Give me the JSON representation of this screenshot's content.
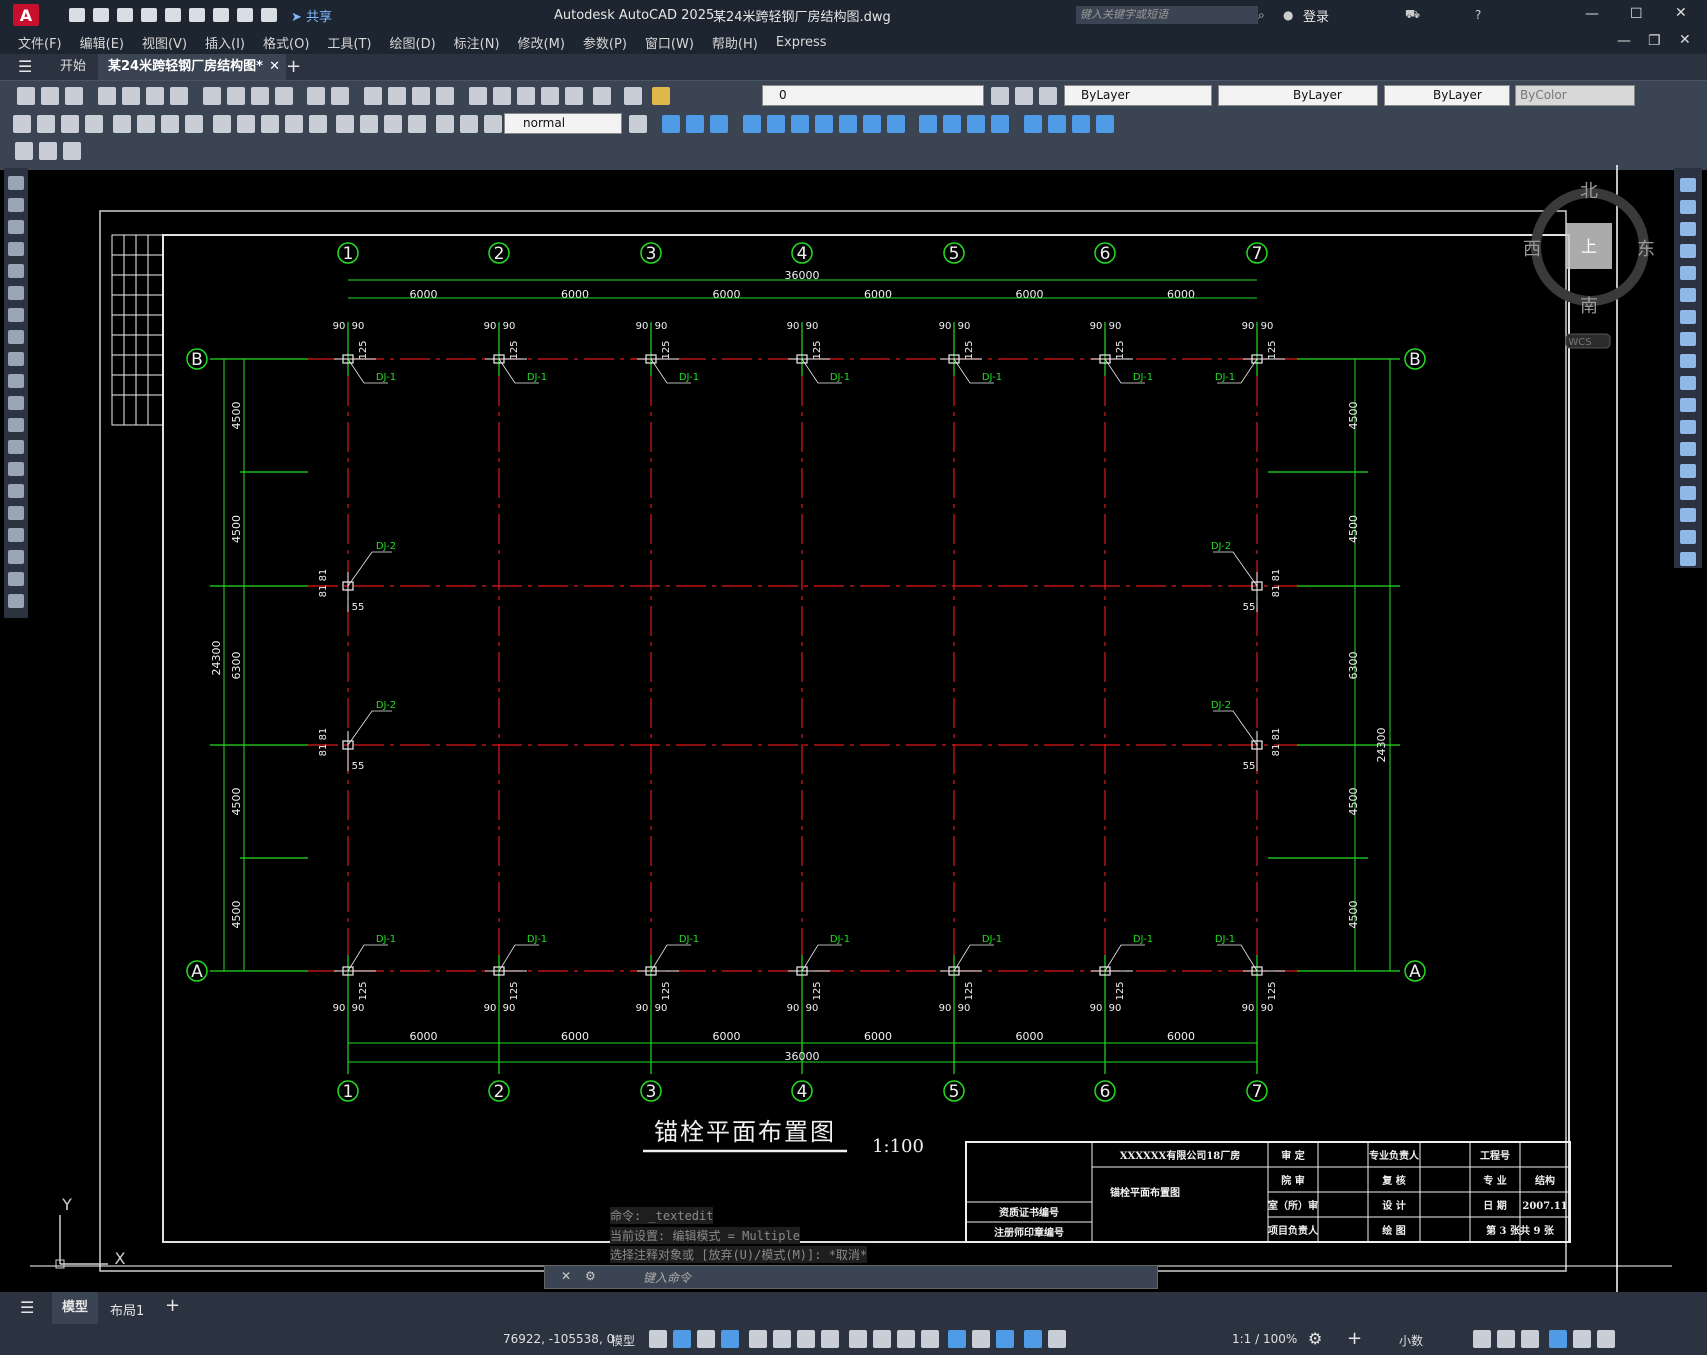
{
  "title_bar": {
    "app_title": "Autodesk AutoCAD 2025",
    "file_name": "某24米跨轻钢厂房结构图.dwg",
    "search_placeholder": "键入关键字或短语",
    "login": "登录",
    "share": "共享"
  },
  "menu": [
    "文件(F)",
    "编辑(E)",
    "视图(V)",
    "插入(I)",
    "格式(O)",
    "工具(T)",
    "绘图(D)",
    "标注(N)",
    "修改(M)",
    "参数(P)",
    "窗口(W)",
    "帮助(H)",
    "Express"
  ],
  "tabs": {
    "start": "开始",
    "doc": "某24米跨轻钢厂房结构图*"
  },
  "toolbar": {
    "layer_value": "0",
    "color": "ByLayer",
    "linetype": "ByLayer",
    "lineweight": "ByLayer",
    "plotstyle": "ByColor",
    "dimstyle": "normal"
  },
  "drawing": {
    "column_labels": [
      "1",
      "2",
      "3",
      "4",
      "5",
      "6",
      "7"
    ],
    "row_labels": [
      "B",
      "A"
    ],
    "bay_width": "6000",
    "total_width": "36000",
    "total_depth": "24300",
    "side_dims": [
      "4500",
      "4500",
      "6300",
      "4500",
      "4500"
    ],
    "anchor_offsets": [
      "90",
      "90",
      "125"
    ],
    "side_offsets": [
      "81",
      "81",
      "55"
    ],
    "tag_dj1": "DJ-1",
    "tag_dj2": "DJ-2",
    "title": "锚栓平面布置图",
    "scale": "1:100",
    "title_block": {
      "company": "XXXXXX有限公司18厂房",
      "drawing_name": "锚栓平面布置图",
      "cert_no": "资质证书编号",
      "reg_no": "注册师印章编号",
      "r1": [
        "审 定",
        "专业负责人",
        "工程号"
      ],
      "r2": [
        "院 审",
        "复 核",
        "专 业",
        "结构"
      ],
      "r3": [
        "室（所）审",
        "设 计",
        "日 期",
        "2007.11"
      ],
      "r4": [
        "项目负责人",
        "绘 图",
        "第 3 张共 9 张"
      ]
    }
  },
  "viewcube": {
    "north": "北",
    "south": "南",
    "east": "东",
    "west": "西",
    "top": "上",
    "wcs": "WCS"
  },
  "command": {
    "history": [
      "命令: _textedit",
      "当前设置: 编辑模式 = Multiple",
      "选择注释对象或 [放弃(U)/模式(M)]: *取消*"
    ],
    "placeholder": "键入命令"
  },
  "layout_tabs": [
    "模型",
    "布局1"
  ],
  "status": {
    "coords": "76922, -105538, 0",
    "space": "模型",
    "anno_scale": "1:1 / 100%",
    "units": "小数"
  },
  "ucs": {
    "x": "X",
    "y": "Y"
  }
}
